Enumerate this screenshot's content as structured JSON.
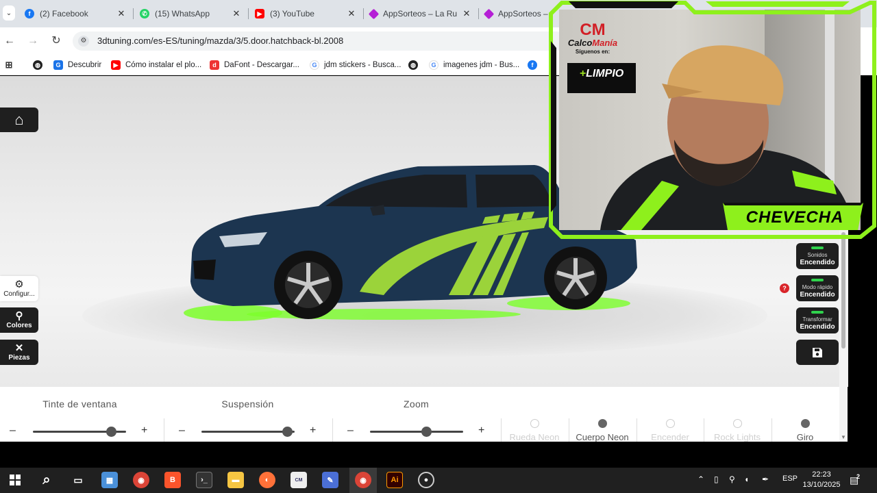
{
  "browser": {
    "tabs": [
      {
        "label": "(2) Facebook",
        "icon": "facebook-icon",
        "color": "#1877f2"
      },
      {
        "label": "(15) WhatsApp",
        "icon": "whatsapp-icon",
        "color": "#25d366"
      },
      {
        "label": "(3) YouTube",
        "icon": "youtube-icon",
        "color": "#ff0000"
      },
      {
        "label": "AppSorteos – La Ru",
        "icon": "appsorteos-icon",
        "color": "#b51fd6"
      },
      {
        "label": "AppSorteos – La",
        "icon": "appsorteos-icon",
        "color": "#b51fd6"
      }
    ],
    "url": "3dtuning.com/es-ES/tuning/mazda/3/5.door.hatchback-bl.2008",
    "bookmarks": [
      {
        "label": "",
        "icon": "apps-grid-icon"
      },
      {
        "label": "",
        "icon": "globe-icon"
      },
      {
        "label": "Descubrir",
        "icon": "descubrir-icon"
      },
      {
        "label": "Cómo instalar el plo...",
        "icon": "youtube-icon"
      },
      {
        "label": "DaFont - Descargar...",
        "icon": "dafont-icon"
      },
      {
        "label": "jdm stickers - Busca...",
        "icon": "google-icon"
      },
      {
        "label": "",
        "icon": "globe-icon"
      },
      {
        "label": "imagenes jdm - Bus...",
        "icon": "google-icon"
      },
      {
        "label": "",
        "icon": "facebook-icon"
      }
    ]
  },
  "app": {
    "left_menu": {
      "config_label": "Configur...",
      "colors_label": "Colores",
      "parts_label": "Piezas"
    },
    "right_toggles": [
      {
        "title": "Sonidos",
        "state": "Encendido"
      },
      {
        "title": "Modo rápido",
        "state": "Encendido"
      },
      {
        "title": "Transformar",
        "state": "Encendido"
      }
    ],
    "help_badge": "?",
    "sliders": [
      {
        "label": "Tinte de ventana",
        "minus": "–",
        "plus": "+",
        "value": 0.84
      },
      {
        "label": "Suspensión",
        "minus": "–",
        "plus": "+",
        "value": 0.92
      },
      {
        "label": "Zoom",
        "minus": "–",
        "plus": "+",
        "value": 0.6
      }
    ],
    "options": [
      {
        "label": "Rueda Neon",
        "selected": false
      },
      {
        "label": "Cuerpo Neon",
        "selected": true
      },
      {
        "label": "Encender",
        "selected": false
      },
      {
        "label": "Rock Lights",
        "selected": false
      },
      {
        "label": "Giro",
        "selected": true
      }
    ],
    "car": {
      "body_color": "#1c3550",
      "accent_color": "#9bd33a",
      "neon_color": "#7cff2a"
    }
  },
  "webcam": {
    "logo_top": "CM",
    "logo_brand_a": "Calco",
    "logo_brand_b": "Manía",
    "logo_follow": "Síguenos en:",
    "sponsor_plus": "+",
    "sponsor_name": "LIMPIO",
    "streamer_name": "CHEVECHA",
    "frame_color": "#8ef01c"
  },
  "taskbar": {
    "language": "ESP",
    "time": "22:23",
    "date": "13/10/2025",
    "notifications": "2"
  }
}
